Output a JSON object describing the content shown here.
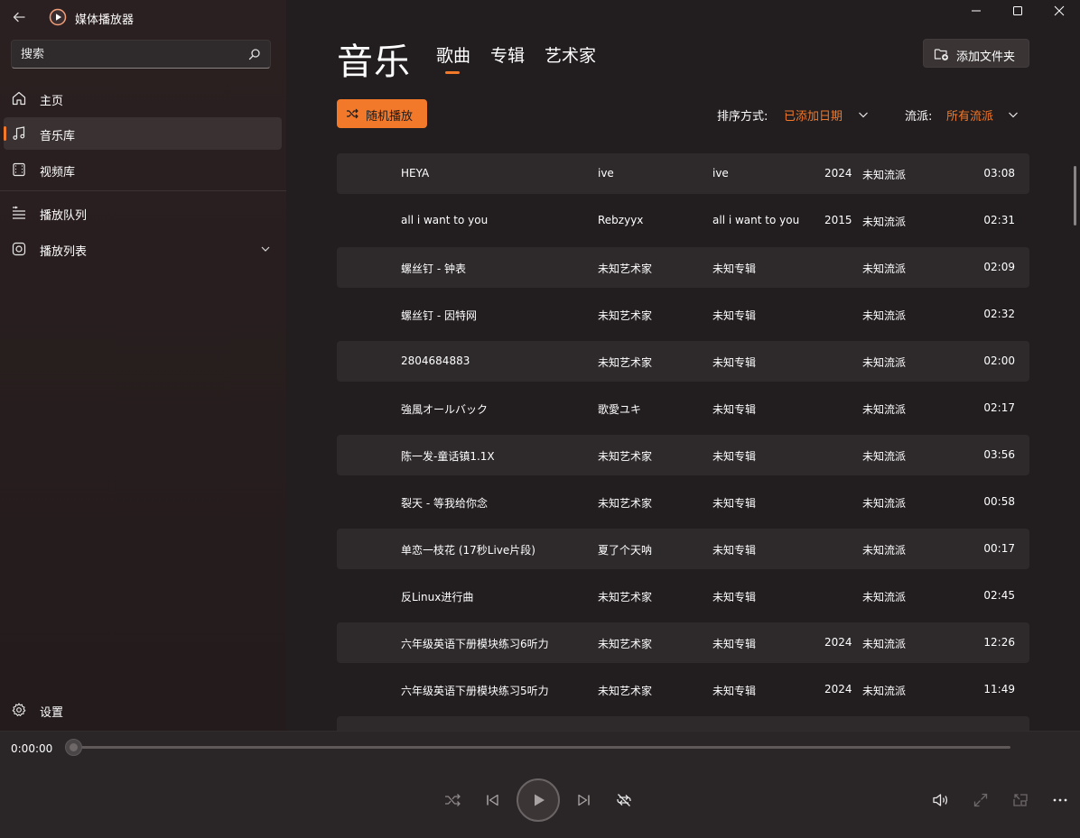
{
  "app": {
    "title": "媒体播放器"
  },
  "sidebar": {
    "search_placeholder": "搜索",
    "items": [
      {
        "label": "主页",
        "icon": "home-icon"
      },
      {
        "label": "音乐库",
        "icon": "music-note-icon",
        "active": true
      },
      {
        "label": "视频库",
        "icon": "video-icon"
      },
      {
        "label": "播放队列",
        "icon": "queue-icon"
      },
      {
        "label": "播放列表",
        "icon": "playlist-icon"
      }
    ],
    "settings_label": "设置"
  },
  "header": {
    "page_title": "音乐",
    "tabs": [
      {
        "label": "歌曲",
        "active": true
      },
      {
        "label": "专辑"
      },
      {
        "label": "艺术家"
      }
    ],
    "add_folder_label": "添加文件夹"
  },
  "toolbar": {
    "shuffle_label": "随机播放",
    "sort_label": "排序方式:",
    "sort_value": "已添加日期",
    "genre_label": "流派:",
    "genre_value": "所有流派"
  },
  "songs": [
    {
      "title": "HEYA",
      "artist": "ive",
      "album": "ive",
      "year": "2024",
      "genre": "未知流派",
      "duration": "03:08"
    },
    {
      "title": "all i want to you",
      "artist": "Rebzyyx",
      "album": "all i want to you",
      "year": "2015",
      "genre": "未知流派",
      "duration": "02:31"
    },
    {
      "title": "螺丝钉 - 钟表",
      "artist": "未知艺术家",
      "album": "未知专辑",
      "year": "",
      "genre": "未知流派",
      "duration": "02:09"
    },
    {
      "title": "螺丝钉 - 因特网",
      "artist": "未知艺术家",
      "album": "未知专辑",
      "year": "",
      "genre": "未知流派",
      "duration": "02:32"
    },
    {
      "title": "2804684883",
      "artist": "未知艺术家",
      "album": "未知专辑",
      "year": "",
      "genre": "未知流派",
      "duration": "02:00"
    },
    {
      "title": "強風オールバック",
      "artist": "歌愛ユキ",
      "album": "未知专辑",
      "year": "",
      "genre": "未知流派",
      "duration": "02:17"
    },
    {
      "title": "陈一发-童话镇1.1X",
      "artist": "未知艺术家",
      "album": "未知专辑",
      "year": "",
      "genre": "未知流派",
      "duration": "03:56"
    },
    {
      "title": "裂天 - 等我给你念",
      "artist": "未知艺术家",
      "album": "未知专辑",
      "year": "",
      "genre": "未知流派",
      "duration": "00:58"
    },
    {
      "title": "单恋一枝花 (17秒Live片段)",
      "artist": "夏了个天呐",
      "album": "未知专辑",
      "year": "",
      "genre": "未知流派",
      "duration": "00:17"
    },
    {
      "title": "反Linux进行曲",
      "artist": "未知艺术家",
      "album": "未知专辑",
      "year": "",
      "genre": "未知流派",
      "duration": "02:45"
    },
    {
      "title": "六年级英语下册模块练习6听力",
      "artist": "未知艺术家",
      "album": "未知专辑",
      "year": "2024",
      "genre": "未知流派",
      "duration": "12:26"
    },
    {
      "title": "六年级英语下册模块练习5听力",
      "artist": "未知艺术家",
      "album": "未知专辑",
      "year": "2024",
      "genre": "未知流派",
      "duration": "11:49"
    }
  ],
  "player": {
    "current_time": "0:00:00",
    "progress_fraction": 0
  },
  "colors": {
    "accent": "#f2782a",
    "sidebar_bg": "#2a1f20",
    "main_bg": "#221d1e",
    "row_alt_bg": "#2e2a2b",
    "player_bg": "#2a2526"
  }
}
